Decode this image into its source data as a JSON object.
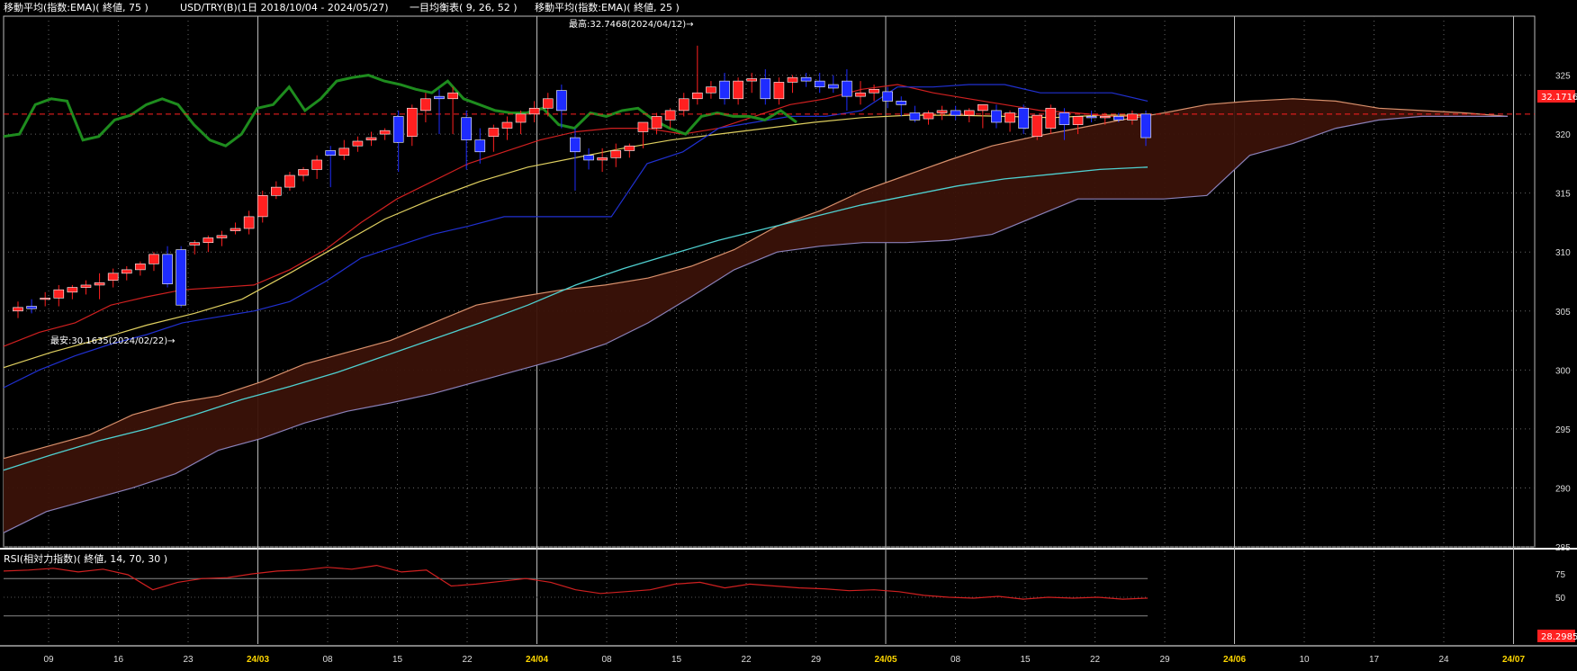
{
  "header": {
    "ema75": "移動平均(指数:EMA)( 終値, 75 )",
    "symbol": "USD/TRY(B)(1日 2018/10/04 - 2024/05/27)",
    "ichimoku": "一目均衡表( 9, 26, 52 )",
    "ema25": "移動平均(指数:EMA)( 終値, 25 )"
  },
  "annotations": {
    "high": "最高:32.7468(2024/04/12)→",
    "low": "最安:30.1635(2024/02/22)→",
    "last_price": "32.1716",
    "rsi_last": "28.2985"
  },
  "colors": {
    "up": "#ff2020",
    "down": "#1e2cff",
    "ema75": "#4fd0d0",
    "ema25": "#e0d060",
    "tenkan": "#d02020",
    "kijun": "#2030d0",
    "chikou": "#1e8c1e",
    "cloud_fill": "#3a1208",
    "span_a": "#d8906c",
    "span_b": "#8a80b8",
    "rsi_line": "#d02020",
    "last_price": "#ff2020"
  },
  "chart_data": [
    {
      "type": "candlestick",
      "title": "USD/TRY(B)(1日 2018/10/04 - 2024/05/27)",
      "ylim": [
        28.5,
        33.0
      ],
      "y_ticks": [
        "325",
        "320",
        "315",
        "310",
        "305",
        "300",
        "295",
        "290",
        "285"
      ],
      "x_ticks": [
        "09",
        "16",
        "23",
        "24/03",
        "08",
        "15",
        "22",
        "24/04",
        "08",
        "15",
        "22",
        "29",
        "24/05",
        "08",
        "15",
        "22",
        "29",
        "24/06",
        "10",
        "17",
        "24",
        "24/07"
      ],
      "candles": [
        {
          "o": 30.5,
          "h": 30.58,
          "l": 30.44,
          "c": 30.53
        },
        {
          "o": 30.54,
          "h": 30.6,
          "l": 30.48,
          "c": 30.52
        },
        {
          "o": 30.6,
          "h": 30.66,
          "l": 30.54,
          "c": 30.61
        },
        {
          "o": 30.61,
          "h": 30.72,
          "l": 30.54,
          "c": 30.68
        },
        {
          "o": 30.66,
          "h": 30.72,
          "l": 30.6,
          "c": 30.7
        },
        {
          "o": 30.7,
          "h": 30.76,
          "l": 30.64,
          "c": 30.72
        },
        {
          "o": 30.72,
          "h": 30.82,
          "l": 30.6,
          "c": 30.74
        },
        {
          "o": 30.76,
          "h": 30.86,
          "l": 30.7,
          "c": 30.82
        },
        {
          "o": 30.82,
          "h": 30.88,
          "l": 30.76,
          "c": 30.85
        },
        {
          "o": 30.85,
          "h": 30.92,
          "l": 30.8,
          "c": 30.9
        },
        {
          "o": 30.9,
          "h": 31.0,
          "l": 30.84,
          "c": 30.98
        },
        {
          "o": 30.98,
          "h": 31.05,
          "l": 30.7,
          "c": 30.73
        },
        {
          "o": 31.02,
          "h": 31.05,
          "l": 30.53,
          "c": 30.55
        },
        {
          "o": 31.06,
          "h": 31.1,
          "l": 30.98,
          "c": 31.08
        },
        {
          "o": 31.08,
          "h": 31.14,
          "l": 31.0,
          "c": 31.12
        },
        {
          "o": 31.12,
          "h": 31.18,
          "l": 31.05,
          "c": 31.14
        },
        {
          "o": 31.18,
          "h": 31.25,
          "l": 31.15,
          "c": 31.2
        },
        {
          "o": 31.2,
          "h": 31.35,
          "l": 31.15,
          "c": 31.3
        },
        {
          "o": 31.3,
          "h": 31.52,
          "l": 31.25,
          "c": 31.48
        },
        {
          "o": 31.48,
          "h": 31.6,
          "l": 31.45,
          "c": 31.55
        },
        {
          "o": 31.55,
          "h": 31.68,
          "l": 31.52,
          "c": 31.65
        },
        {
          "o": 31.65,
          "h": 31.72,
          "l": 31.6,
          "c": 31.7
        },
        {
          "o": 31.7,
          "h": 31.82,
          "l": 31.62,
          "c": 31.78
        },
        {
          "o": 31.86,
          "h": 31.9,
          "l": 31.55,
          "c": 31.82
        },
        {
          "o": 31.82,
          "h": 31.95,
          "l": 31.78,
          "c": 31.88
        },
        {
          "o": 31.9,
          "h": 31.98,
          "l": 31.85,
          "c": 31.94
        },
        {
          "o": 31.95,
          "h": 32.02,
          "l": 31.9,
          "c": 31.97
        },
        {
          "o": 32.0,
          "h": 32.05,
          "l": 31.95,
          "c": 32.03
        },
        {
          "o": 32.15,
          "h": 32.2,
          "l": 31.68,
          "c": 31.93
        },
        {
          "o": 31.98,
          "h": 32.25,
          "l": 31.9,
          "c": 32.22
        },
        {
          "o": 32.2,
          "h": 32.35,
          "l": 32.1,
          "c": 32.3
        },
        {
          "o": 32.32,
          "h": 32.38,
          "l": 32.0,
          "c": 32.3
        },
        {
          "o": 32.3,
          "h": 32.4,
          "l": 32.0,
          "c": 32.35
        },
        {
          "o": 32.14,
          "h": 32.2,
          "l": 31.7,
          "c": 31.95
        },
        {
          "o": 31.95,
          "h": 32.05,
          "l": 31.75,
          "c": 31.85
        },
        {
          "o": 31.98,
          "h": 32.08,
          "l": 31.85,
          "c": 32.05
        },
        {
          "o": 32.05,
          "h": 32.15,
          "l": 31.95,
          "c": 32.1
        },
        {
          "o": 32.1,
          "h": 32.2,
          "l": 32.0,
          "c": 32.17
        },
        {
          "o": 32.17,
          "h": 32.28,
          "l": 32.1,
          "c": 32.22
        },
        {
          "o": 32.22,
          "h": 32.35,
          "l": 32.15,
          "c": 32.3
        },
        {
          "o": 32.37,
          "h": 32.42,
          "l": 32.05,
          "c": 32.2
        },
        {
          "o": 31.97,
          "h": 32.05,
          "l": 31.52,
          "c": 31.85
        },
        {
          "o": 31.82,
          "h": 31.88,
          "l": 31.7,
          "c": 31.78
        },
        {
          "o": 31.78,
          "h": 31.88,
          "l": 31.68,
          "c": 31.8
        },
        {
          "o": 31.8,
          "h": 31.92,
          "l": 31.72,
          "c": 31.86
        },
        {
          "o": 31.86,
          "h": 31.92,
          "l": 31.8,
          "c": 31.9
        },
        {
          "o": 32.02,
          "h": 32.1,
          "l": 31.88,
          "c": 32.1
        },
        {
          "o": 32.05,
          "h": 32.18,
          "l": 32.0,
          "c": 32.15
        },
        {
          "o": 32.12,
          "h": 32.22,
          "l": 32.05,
          "c": 32.2
        },
        {
          "o": 32.2,
          "h": 32.35,
          "l": 32.15,
          "c": 32.3
        },
        {
          "o": 32.3,
          "h": 32.75,
          "l": 32.25,
          "c": 32.35
        },
        {
          "o": 32.35,
          "h": 32.45,
          "l": 32.3,
          "c": 32.4
        },
        {
          "o": 32.45,
          "h": 32.52,
          "l": 32.25,
          "c": 32.3
        },
        {
          "o": 32.3,
          "h": 32.48,
          "l": 32.25,
          "c": 32.45
        },
        {
          "o": 32.45,
          "h": 32.52,
          "l": 32.35,
          "c": 32.47
        },
        {
          "o": 32.47,
          "h": 32.55,
          "l": 32.25,
          "c": 32.3
        },
        {
          "o": 32.3,
          "h": 32.48,
          "l": 32.25,
          "c": 32.44
        },
        {
          "o": 32.44,
          "h": 32.5,
          "l": 32.35,
          "c": 32.48
        },
        {
          "o": 32.48,
          "h": 32.52,
          "l": 32.4,
          "c": 32.45
        },
        {
          "o": 32.45,
          "h": 32.52,
          "l": 32.35,
          "c": 32.4
        },
        {
          "o": 32.42,
          "h": 32.5,
          "l": 32.35,
          "c": 32.39
        },
        {
          "o": 32.45,
          "h": 32.55,
          "l": 32.2,
          "c": 32.32
        },
        {
          "o": 32.32,
          "h": 32.45,
          "l": 32.25,
          "c": 32.35
        },
        {
          "o": 32.35,
          "h": 32.42,
          "l": 32.28,
          "c": 32.38
        },
        {
          "o": 32.36,
          "h": 32.4,
          "l": 32.22,
          "c": 32.28
        },
        {
          "o": 32.28,
          "h": 32.32,
          "l": 32.15,
          "c": 32.25
        },
        {
          "o": 32.18,
          "h": 32.24,
          "l": 32.1,
          "c": 32.12
        },
        {
          "o": 32.13,
          "h": 32.2,
          "l": 32.08,
          "c": 32.18
        },
        {
          "o": 32.18,
          "h": 32.24,
          "l": 32.12,
          "c": 32.2
        },
        {
          "o": 32.2,
          "h": 32.24,
          "l": 32.12,
          "c": 32.16
        },
        {
          "o": 32.16,
          "h": 32.22,
          "l": 32.1,
          "c": 32.2
        },
        {
          "o": 32.2,
          "h": 32.25,
          "l": 32.05,
          "c": 32.25
        },
        {
          "o": 32.2,
          "h": 32.25,
          "l": 32.05,
          "c": 32.1
        },
        {
          "o": 32.1,
          "h": 32.2,
          "l": 32.02,
          "c": 32.18
        },
        {
          "o": 32.22,
          "h": 32.25,
          "l": 32.0,
          "c": 32.05
        },
        {
          "o": 31.98,
          "h": 32.16,
          "l": 31.95,
          "c": 32.16
        },
        {
          "o": 32.05,
          "h": 32.25,
          "l": 32.0,
          "c": 32.22
        },
        {
          "o": 32.18,
          "h": 32.22,
          "l": 31.95,
          "c": 32.08
        },
        {
          "o": 32.08,
          "h": 32.15,
          "l": 32.0,
          "c": 32.15
        },
        {
          "o": 32.15,
          "h": 32.2,
          "l": 32.1,
          "c": 32.14
        },
        {
          "o": 32.14,
          "h": 32.18,
          "l": 32.08,
          "c": 32.15
        },
        {
          "o": 32.15,
          "h": 32.18,
          "l": 32.1,
          "c": 32.12
        },
        {
          "o": 32.12,
          "h": 32.2,
          "l": 32.08,
          "c": 32.17
        },
        {
          "o": 32.17,
          "h": 32.2,
          "l": 31.9,
          "c": 31.97
        }
      ],
      "series": [
        {
          "name": "移動平均(指数:EMA)( 終値, 75 )",
          "values": [
            29.15,
            29.28,
            29.4,
            29.5,
            29.62,
            29.75,
            29.86,
            29.98,
            30.12,
            30.26,
            30.4,
            30.55,
            30.72,
            30.86,
            30.98,
            31.1,
            31.2,
            31.3,
            31.4,
            31.48,
            31.56,
            31.62,
            31.66,
            31.7,
            31.72
          ]
        },
        {
          "name": "移動平均(指数:EMA)( 終値, 25 )",
          "values": [
            30.02,
            30.15,
            30.26,
            30.38,
            30.48,
            30.6,
            30.82,
            31.05,
            31.28,
            31.45,
            31.6,
            31.72,
            31.8,
            31.88,
            31.95,
            32.0,
            32.05,
            32.1,
            32.14,
            32.16,
            32.16,
            32.15,
            32.14,
            32.16,
            32.16
          ]
        },
        {
          "name": "RSI(相対力指数)( 終値, 14, 70, 30 )",
          "values": [
            78,
            79,
            81,
            77,
            80,
            74,
            58,
            66,
            70,
            71,
            75,
            78,
            79,
            82,
            80,
            84,
            77,
            79,
            62,
            64,
            67,
            70,
            66,
            58,
            54,
            56,
            58,
            64,
            66,
            60,
            64,
            62,
            60,
            59,
            57,
            58,
            56,
            52,
            50,
            49,
            51,
            48,
            50,
            49,
            50,
            48,
            49
          ]
        }
      ]
    }
  ]
}
